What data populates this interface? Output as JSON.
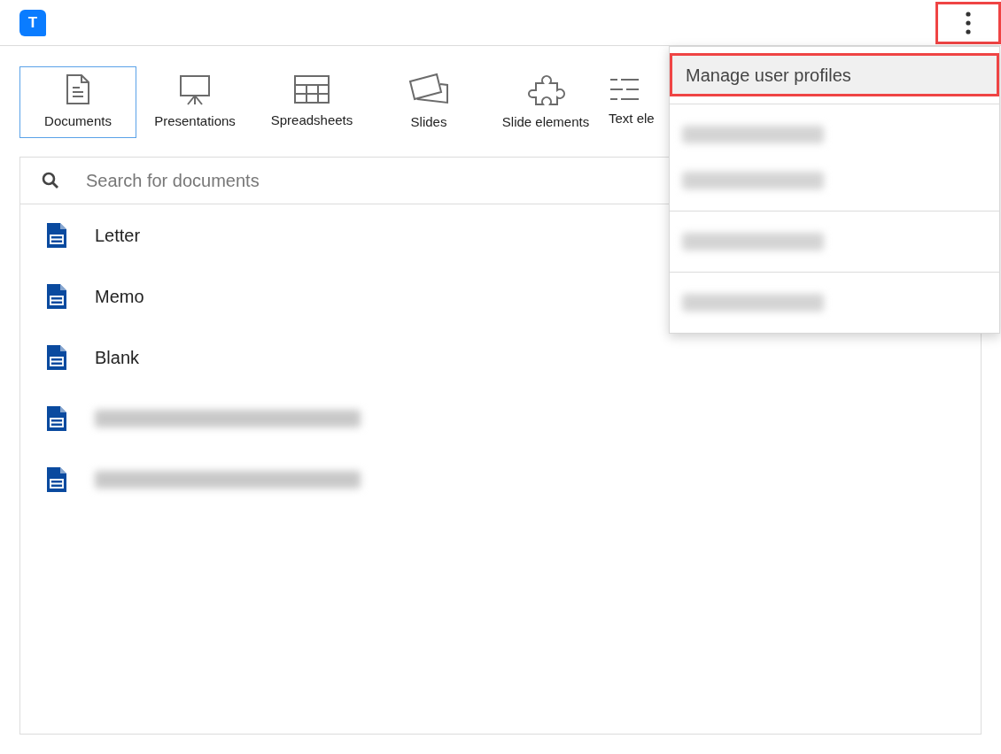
{
  "header": {
    "logo": "T",
    "menu_button": {
      "highlighted": true
    }
  },
  "tabs": [
    {
      "label": "Documents",
      "selected": true
    },
    {
      "label": "Presentations",
      "selected": false
    },
    {
      "label": "Spreadsheets",
      "selected": false
    },
    {
      "label": "Slides",
      "selected": false
    },
    {
      "label": "Slide elements",
      "selected": false
    },
    {
      "label": "Text ele",
      "selected": false
    }
  ],
  "search": {
    "placeholder": "Search for documents"
  },
  "documents": [
    {
      "kind": "text",
      "name": "Letter"
    },
    {
      "kind": "text",
      "name": "Memo"
    },
    {
      "kind": "text",
      "name": "Blank"
    },
    {
      "kind": "redacted"
    },
    {
      "kind": "redacted"
    }
  ],
  "menu": {
    "items": [
      {
        "kind": "text",
        "label": "Manage user profiles",
        "highlighted": true,
        "divider_after": true
      },
      {
        "kind": "redacted",
        "divider_after": false
      },
      {
        "kind": "redacted",
        "divider_after": true
      },
      {
        "kind": "redacted",
        "divider_after": true
      },
      {
        "kind": "redacted",
        "divider_after": false
      }
    ]
  }
}
